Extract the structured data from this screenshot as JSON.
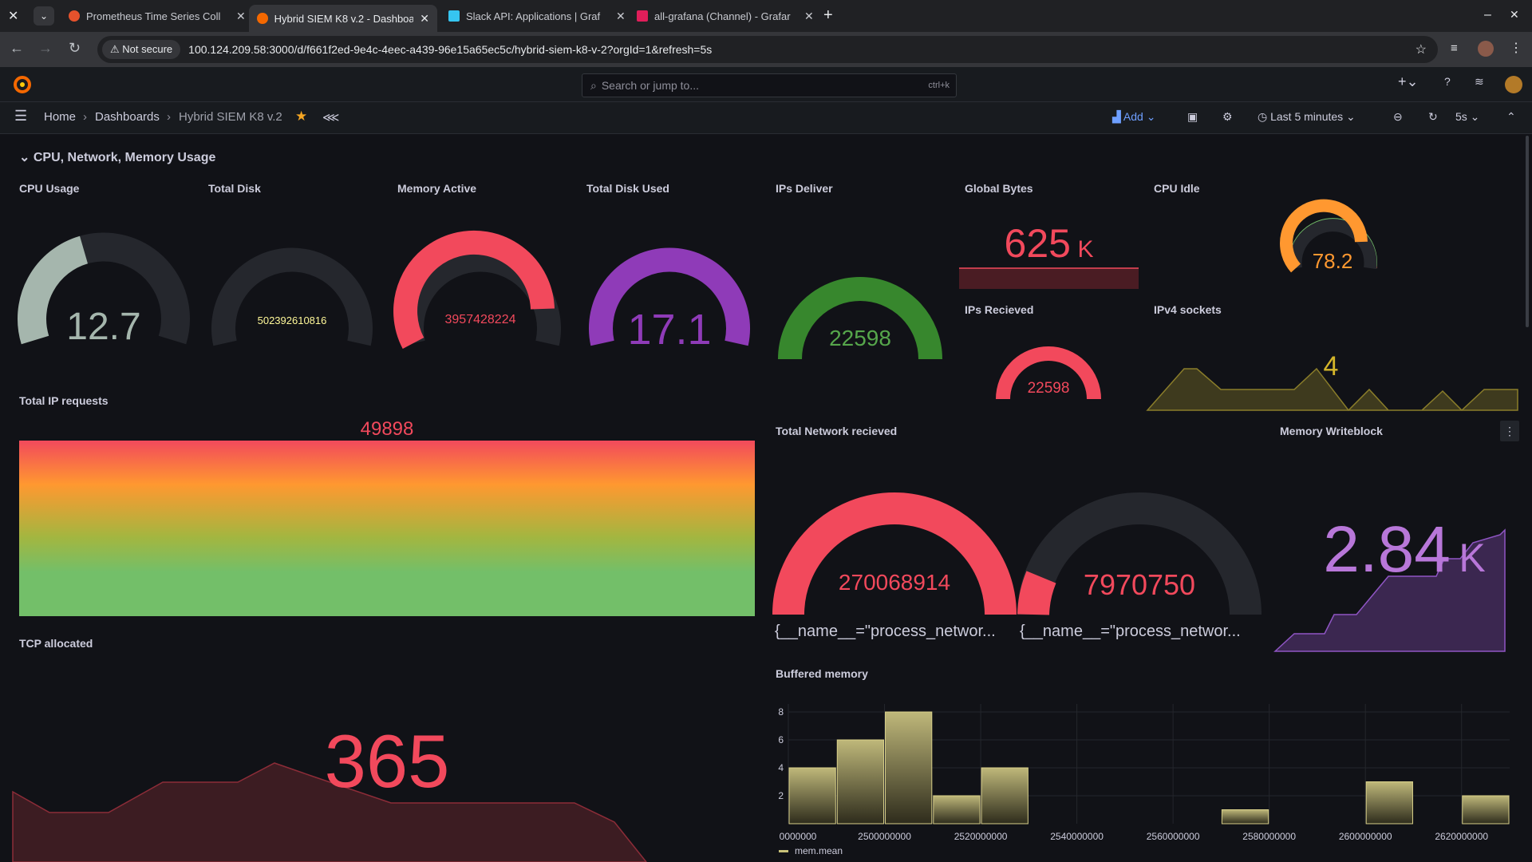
{
  "browser": {
    "tabs": [
      {
        "title": "Prometheus Time Series Coll",
        "color": "#e6522c"
      },
      {
        "title": "Hybrid SIEM K8 v.2 - Dashboard",
        "color": "#f46800"
      },
      {
        "title": "Slack API: Applications | Graf",
        "color": "#36c5f0"
      },
      {
        "title": "all-grafana (Channel) - Grafar",
        "color": "#e01e5a"
      }
    ],
    "not_secure": "Not secure",
    "url": "100.124.209.58:3000/d/f661f2ed-9e4c-4eec-a439-96e15a65ec5c/hybrid-siem-k8-v-2?orgId=1&refresh=5s"
  },
  "topbar": {
    "search_placeholder": "Search or jump to...",
    "shortcut": "ctrl+k"
  },
  "breadcrumb": {
    "home": "Home",
    "dashboards": "Dashboards",
    "current": "Hybrid SIEM K8 v.2"
  },
  "toolbar": {
    "add_label": "Add",
    "time_range": "Last 5 minutes",
    "refresh_interval": "5s"
  },
  "row_title": "CPU, Network, Memory Usage",
  "panels": {
    "cpu_usage": {
      "title": "CPU Usage",
      "value": "12.7",
      "fraction": 0.4
    },
    "total_disk": {
      "title": "Total Disk",
      "value": "502392610816"
    },
    "memory_active": {
      "title": "Memory Active",
      "value": "3957428224"
    },
    "total_disk_used": {
      "title": "Total Disk Used",
      "value": "17.1"
    },
    "ips_deliver": {
      "title": "IPs Deliver",
      "value": "22598"
    },
    "global_bytes": {
      "title": "Global Bytes",
      "value": "625",
      "unit": "K"
    },
    "cpu_idle": {
      "title": "CPU Idle",
      "value": "78.2"
    },
    "ips_recieved": {
      "title": "IPs Recieved",
      "value": "22598"
    },
    "ipv4_sockets": {
      "title": "IPv4 sockets",
      "value": "4"
    },
    "total_ip_requests": {
      "title": "Total IP requests",
      "value": "49898"
    },
    "total_network_recieved": {
      "title": "Total Network recieved",
      "gauges": [
        {
          "value": "270068914",
          "label": "{__name__=\"process_networ..."
        },
        {
          "value": "7970750",
          "label": "{__name__=\"process_networ..."
        }
      ]
    },
    "memory_writeblock": {
      "title": "Memory Writeblock",
      "value": "2.84",
      "unit": "K"
    },
    "tcp_allocated": {
      "title": "TCP allocated",
      "value": "365"
    },
    "buffered_memory": {
      "title": "Buffered memory",
      "legend": "mem.mean"
    }
  },
  "chart_data": {
    "type": "bar",
    "title": "Buffered memory",
    "x_ticks": [
      "2500000000",
      "2520000000",
      "2540000000",
      "2560000000",
      "2580000000",
      "2600000000",
      "2620000000"
    ],
    "x_tick_first_partial": "0000000",
    "y_ticks": [
      2,
      4,
      6,
      8
    ],
    "ylim": [
      0,
      8
    ],
    "xlim": [
      2480000000,
      2630000000
    ],
    "bin_width": 10000000,
    "bins": [
      {
        "x": 2480000000,
        "count": 4
      },
      {
        "x": 2490000000,
        "count": 6
      },
      {
        "x": 2500000000,
        "count": 8
      },
      {
        "x": 2510000000,
        "count": 2
      },
      {
        "x": 2520000000,
        "count": 4
      },
      {
        "x": 2570000000,
        "count": 1
      },
      {
        "x": 2600000000,
        "count": 3
      },
      {
        "x": 2620000000,
        "count": 2
      }
    ],
    "series": [
      {
        "name": "mem.mean",
        "color": "#c9c27a"
      }
    ]
  }
}
